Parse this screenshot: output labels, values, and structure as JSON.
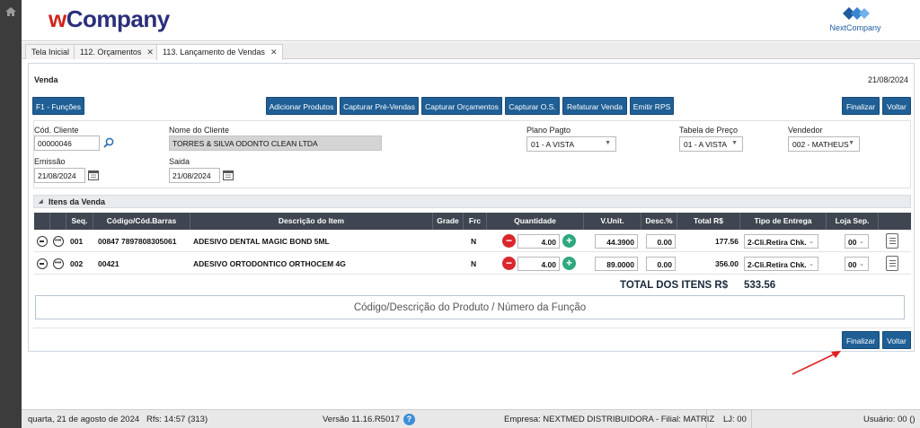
{
  "brand": {
    "w": "w",
    "rest": "Company",
    "partner": "NextCompany"
  },
  "tabs": [
    {
      "label": "Tela Inicial",
      "close": ""
    },
    {
      "label": "112. Orçamentos",
      "close": "✕"
    },
    {
      "label": "113. Lançamento de Vendas",
      "close": "✕"
    }
  ],
  "header": {
    "title": "Venda",
    "date": "21/08/2024"
  },
  "toolbar": {
    "funcoes": "F1 - Funções",
    "adicionar": "Adicionar Produtos",
    "prevendas": "Capturar Pré-Vendas",
    "orcamentos": "Capturar Orçamentos",
    "os": "Capturar O.S.",
    "refaturar": "Refaturar Venda",
    "rps": "Emitir RPS",
    "finalizar": "Finalizar",
    "voltar": "Voltar"
  },
  "form": {
    "cod_cliente_label": "Cód. Cliente",
    "cod_cliente": "00000046",
    "nome_cliente_label": "Nome do Cliente",
    "nome_cliente": "TORRES & SILVA ODONTO CLEAN LTDA",
    "plano_label": "Plano Pagto",
    "plano": "01 - A VISTA",
    "tabela_label": "Tabela de Preço",
    "tabela": "01 - A VISTA",
    "vendedor_label": "Vendedor",
    "vendedor": "002 - MATHEUS",
    "emissao_label": "Emissão",
    "emissao": "21/08/2024",
    "saida_label": "Saida",
    "saida": "21/08/2024"
  },
  "items": {
    "section_title": "Itens da Venda",
    "columns": [
      "Seq.",
      "Código/Cód.Barras",
      "Descrição do Item",
      "Grade",
      "Frc",
      "Quantidade",
      "V.Unit.",
      "Desc.%",
      "Total R$",
      "Tipo de Entrega",
      "Loja Sep."
    ],
    "rows": [
      {
        "seq": "001",
        "codigo": "00847 7897808305061",
        "descricao": "ADESIVO DENTAL MAGIC BOND 5ML",
        "grade": "",
        "frc": "N",
        "qtd": "4.00",
        "vunit": "44.3900",
        "desc": "0.00",
        "total": "177.56",
        "entrega": "2-Cli.Retira Chk.",
        "loja": "00"
      },
      {
        "seq": "002",
        "codigo": "00421",
        "descricao": "ADESIVO ORTODONTICO ORTHOCEM 4G",
        "grade": "",
        "frc": "N",
        "qtd": "4.00",
        "vunit": "89.0000",
        "desc": "0.00",
        "total": "356.00",
        "entrega": "2-Cli.Retira Chk.",
        "loja": "00"
      }
    ],
    "total_label": "TOTAL DOS ITENS R$",
    "total_value": "533.56",
    "search_placeholder": "Código/Descrição do Produto / Número da Função"
  },
  "footer_buttons": {
    "finalizar": "Finalizar",
    "voltar": "Voltar"
  },
  "status": {
    "date": "quarta, 21 de agosto de 2024",
    "rfs": "Rfs: 14:57 (313)",
    "versao": "Versão 11.16.R5017",
    "help": "?",
    "empresa": "Empresa: NEXTMED DISTRIBUIDORA - Filial: MATRIZ",
    "lj": "LJ: 00",
    "usuario": "Usuário: 00 ()"
  },
  "colors": {
    "button": "#1f5f96",
    "grid_header": "#3f4651",
    "minus": "#d9262c",
    "plus": "#2ea87e",
    "arrow": "#e02020"
  }
}
